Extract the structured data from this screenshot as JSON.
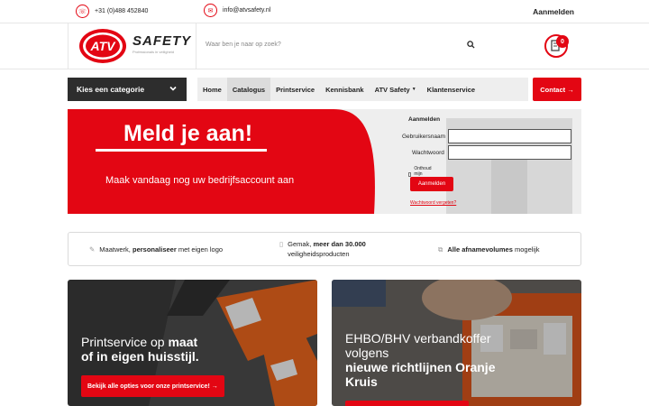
{
  "topbar": {
    "phone": "+31 (0)488 452840",
    "email": "info@atvsafety.nl",
    "login": "Aanmelden",
    "phone_icon": "phone-icon",
    "email_icon": "mail-icon"
  },
  "header": {
    "brand": "SAFETY",
    "logo_text": "ATV",
    "tagline": "Professionals in veiligheid",
    "search_placeholder": "Waar ben je naar op zoek?",
    "cart_count": "0"
  },
  "nav": {
    "category_button": "Kies een categorie",
    "items": [
      "Home",
      "Catalogus",
      "Printservice",
      "Kennisbank",
      "ATV Safety",
      "Klantenservice"
    ],
    "active_index": 1,
    "contact": "Contact"
  },
  "banner": {
    "title": "Meld je aan!",
    "subtitle": "Maak vandaag nog uw bedrijfsaccount aan",
    "form_title": "Aanmelden",
    "username_label": "Gebruikersnaam",
    "password_label": "Wachtwoord",
    "remember_label": "Onthoud mijn gegevens",
    "submit_label": "Aanmelden",
    "forgot_label": "Wachtwoord vergeten?"
  },
  "usps": {
    "u1_pre": "Maatwerk, ",
    "u1_bold": "personaliseer",
    "u1_post": " met eigen logo",
    "u2_pre": "Gemak, ",
    "u2_bold": "meer dan 30.000",
    "u2_line2": "veiligheidsproducten",
    "u3_bold": "Alle afnamevolumes",
    "u3_post": " mogelijk"
  },
  "cards": {
    "c1_l1_pre": "Printservice op ",
    "c1_l1_bold": "maat",
    "c1_l2": "of in eigen huisstijl.",
    "c1_cta": "Bekijk alle opties voor onze printservice!",
    "c2_l1": "EHBO/BHV verbandkoffer",
    "c2_l2": "volgens",
    "c2_l3": "nieuwe richtlijnen Oranje",
    "c2_l4": "Kruis"
  },
  "colors": {
    "accent": "#e30613",
    "dark": "#2d2d2d"
  }
}
